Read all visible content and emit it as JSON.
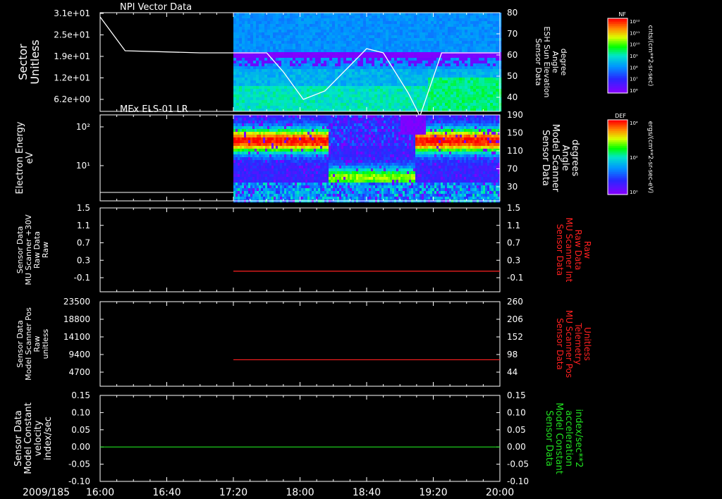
{
  "date_label": "2009/185",
  "time_ticks": [
    "16:00",
    "16:40",
    "17:20",
    "18:00",
    "18:40",
    "19:20",
    "20:00"
  ],
  "colors": {
    "background": "#000000",
    "axis": "#ffffff",
    "red_trace": "#ff2020",
    "green_trace": "#20e020"
  },
  "colorbars": [
    {
      "label": "NF",
      "units": "cnts/(cm**2-sr-sec)",
      "ticks": [
        "10¹²",
        "10¹¹",
        "10¹⁰",
        "10⁹",
        "10⁸",
        "10⁷",
        "10⁶"
      ],
      "log": true
    },
    {
      "label": "DEF",
      "units": "ergs/(cm**2-sr-sec-eV)",
      "ticks": [
        "10⁴",
        "10²",
        "10⁰"
      ],
      "log": true
    }
  ],
  "chart_data": [
    {
      "type": "heatmap",
      "title": "NPI Vector Data",
      "ylabel": "Sector\nUnitless",
      "y_ticks": [
        "3.1e+01",
        "2.5e+01",
        "1.9e+01",
        "1.2e+01",
        "6.2e+00"
      ],
      "right_ylabel": "Sensor Data\nESH Sun Elevation\nAngle\ndegree",
      "right_ticks": [
        "80",
        "70",
        "60",
        "50",
        "40"
      ],
      "right_ylim": [
        31,
        80
      ],
      "data_start": "17:20",
      "overlay_line": {
        "units": "degree",
        "points": [
          [
            "16:00",
            78
          ],
          [
            "16:15",
            62
          ],
          [
            "17:00",
            61
          ],
          [
            "17:40",
            61
          ],
          [
            "17:50",
            52
          ],
          [
            "18:02",
            39
          ],
          [
            "18:15",
            43
          ],
          [
            "18:40",
            63
          ],
          [
            "18:50",
            61
          ],
          [
            "19:05",
            42
          ],
          [
            "19:12",
            31
          ],
          [
            "19:25",
            61
          ],
          [
            "20:00",
            61
          ]
        ]
      },
      "grid": false
    },
    {
      "type": "heatmap",
      "title": "MEx ELS-01 LR",
      "ylabel": "Electron Energy\neV",
      "y_ticks": [
        "10²",
        "10¹"
      ],
      "log_y": true,
      "right_ylabel": "Sensor Data\nModel Scanner\nAngle\ndegrees",
      "right_ticks": [
        "190",
        "150",
        "110",
        "70",
        "30"
      ],
      "data_start": "17:20",
      "grid": false
    },
    {
      "type": "line",
      "ylabel": "Sensor Data\nMU Scanner +30V\nRaw Data\nRaw",
      "y_ticks": [
        "1.5",
        "1.1",
        "0.7",
        "0.3",
        "-0.1"
      ],
      "ylim": [
        -0.3,
        1.5
      ],
      "right_ylabel": "Sensor Data\nMU Scanner Int\nRaw Data\nRaw",
      "right_ticks": [
        "1.5",
        "1.1",
        "0.7",
        "0.3",
        "-0.1"
      ],
      "series": [
        {
          "color": "red",
          "x": [
            "17:20",
            "20:00"
          ],
          "y": [
            0.05,
            0.05
          ]
        }
      ],
      "grid": false
    },
    {
      "type": "line",
      "ylabel": "Sensor Data\nModel Scanner Pos\nRaw\nunitless",
      "y_ticks": [
        "23500",
        "18800",
        "14100",
        "9400",
        "4700"
      ],
      "ylim": [
        0,
        23500
      ],
      "right_ylabel": "Sensor Data\nMU Scanner Pos\nTelemetry\nUnitless",
      "right_ticks": [
        "260",
        "206",
        "152",
        "98",
        "44"
      ],
      "series": [
        {
          "color": "red",
          "x": [
            "17:20",
            "20:00"
          ],
          "y": [
            8000,
            8000
          ]
        }
      ],
      "grid": false
    },
    {
      "type": "line",
      "ylabel": "Sensor Data\nModel Constant\nvelocity\nindex/sec",
      "y_ticks": [
        "0.15",
        "0.10",
        "0.05",
        "0.00",
        "-0.05",
        "-0.10"
      ],
      "ylim": [
        -0.1,
        0.15
      ],
      "right_ylabel": "Sensor Data\nModel Constant\nacceleration\nindex/sec**2",
      "right_ticks": [
        "0.15",
        "0.10",
        "0.05",
        "0.00",
        "-0.05",
        "-0.10"
      ],
      "series": [
        {
          "color": "green",
          "x": [
            "16:00",
            "20:00"
          ],
          "y": [
            0.0,
            0.0
          ]
        }
      ],
      "grid": false
    }
  ]
}
